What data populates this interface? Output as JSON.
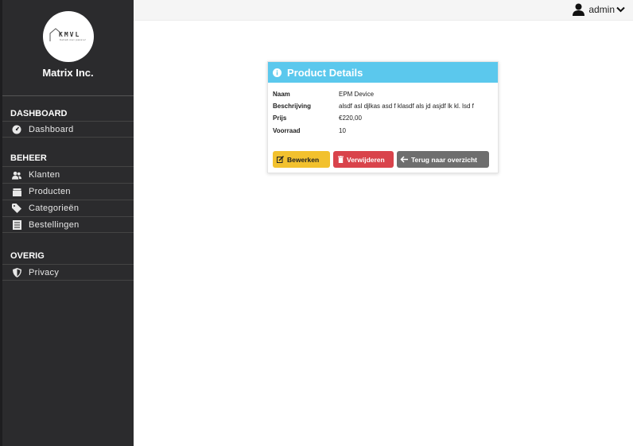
{
  "sidebar": {
    "logo_text": "KMVL",
    "logo_subtext": "Kebab met passie!",
    "brand": "Matrix Inc.",
    "sections": [
      {
        "title": "DASHBOARD",
        "items": [
          {
            "label": "Dashboard",
            "icon": "gauge-icon"
          }
        ]
      },
      {
        "title": "BEHEER",
        "items": [
          {
            "label": "Klanten",
            "icon": "users-icon"
          },
          {
            "label": "Producten",
            "icon": "box-icon"
          },
          {
            "label": "Categorieën",
            "icon": "tag-icon"
          },
          {
            "label": "Bestellingen",
            "icon": "list-icon"
          }
        ]
      },
      {
        "title": "OVERIG",
        "items": [
          {
            "label": "Privacy",
            "icon": "shield-icon"
          }
        ]
      }
    ]
  },
  "topbar": {
    "user": "admin"
  },
  "card": {
    "title": "Product Details",
    "fields": [
      {
        "label": "Naam",
        "value": "EPM Device"
      },
      {
        "label": "Beschrijving",
        "value": "alsdf asl djlkas asd f klasdf als jd asjdf lk kl. lsd f"
      },
      {
        "label": "Prijs",
        "value": "€220,00"
      },
      {
        "label": "Voorraad",
        "value": "10"
      }
    ],
    "buttons": {
      "edit": "Bewerken",
      "delete": "Verwijderen",
      "back": "Terug naar overzicht"
    }
  },
  "colors": {
    "sidebar_bg": "#2b2b2d",
    "header_accent": "#5bc8ed",
    "edit": "#f2c12e",
    "delete": "#d9434b",
    "back": "#6e6e6e"
  }
}
